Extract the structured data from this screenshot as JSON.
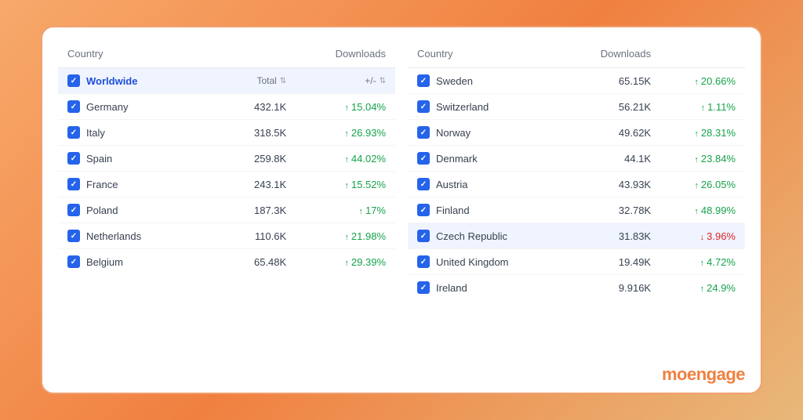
{
  "brand": {
    "name_main": "moen",
    "name_accent": "gage"
  },
  "left_table": {
    "col_country": "Country",
    "col_downloads": "Downloads",
    "col_total": "Total",
    "col_change": "+/-",
    "worldwide_row": {
      "country": "Worldwide",
      "checked": true
    },
    "rows": [
      {
        "country": "Germany",
        "downloads": "432.1K",
        "change": "15.04%",
        "positive": true
      },
      {
        "country": "Italy",
        "downloads": "318.5K",
        "change": "26.93%",
        "positive": true
      },
      {
        "country": "Spain",
        "downloads": "259.8K",
        "change": "44.02%",
        "positive": true
      },
      {
        "country": "France",
        "downloads": "243.1K",
        "change": "15.52%",
        "positive": true
      },
      {
        "country": "Poland",
        "downloads": "187.3K",
        "change": "17%",
        "positive": true
      },
      {
        "country": "Netherlands",
        "downloads": "110.6K",
        "change": "21.98%",
        "positive": true
      },
      {
        "country": "Belgium",
        "downloads": "65.48K",
        "change": "29.39%",
        "positive": true
      }
    ]
  },
  "right_table": {
    "col_country": "Country",
    "col_downloads": "Downloads",
    "rows": [
      {
        "country": "Sweden",
        "downloads": "65.15K",
        "change": "20.66%",
        "positive": true,
        "highlighted": false
      },
      {
        "country": "Switzerland",
        "downloads": "56.21K",
        "change": "1.11%",
        "positive": true,
        "highlighted": false
      },
      {
        "country": "Norway",
        "downloads": "49.62K",
        "change": "28.31%",
        "positive": true,
        "highlighted": false
      },
      {
        "country": "Denmark",
        "downloads": "44.1K",
        "change": "23.84%",
        "positive": true,
        "highlighted": false
      },
      {
        "country": "Austria",
        "downloads": "43.93K",
        "change": "26.05%",
        "positive": true,
        "highlighted": false
      },
      {
        "country": "Finland",
        "downloads": "32.78K",
        "change": "48.99%",
        "positive": true,
        "highlighted": false
      },
      {
        "country": "Czech Republic",
        "downloads": "31.83K",
        "change": "3.96%",
        "positive": false,
        "highlighted": true
      },
      {
        "country": "United Kingdom",
        "downloads": "19.49K",
        "change": "4.72%",
        "positive": true,
        "highlighted": false
      },
      {
        "country": "Ireland",
        "downloads": "9.916K",
        "change": "24.9%",
        "positive": true,
        "highlighted": false
      }
    ]
  }
}
